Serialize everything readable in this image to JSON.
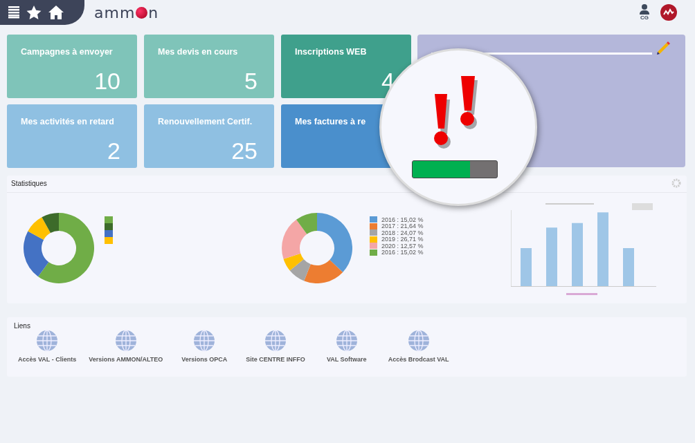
{
  "header": {
    "logo": {
      "before": "amm",
      "after": "n"
    },
    "user": {
      "initials": "CG"
    }
  },
  "tiles": [
    {
      "title": "Campagnes à envoyer",
      "value": "10",
      "color": "#7fc4b9"
    },
    {
      "title": "Mes devis en cours",
      "value": "5",
      "color": "#7fc4b9"
    },
    {
      "title": "Inscriptions WEB",
      "value": "4",
      "color": "#3fa08c"
    },
    {
      "title": "Mes activités en retard",
      "value": "2",
      "color": "#8fc0e2"
    },
    {
      "title": "Renouvellement Certif.",
      "value": "25",
      "color": "#8fc0e2"
    },
    {
      "title": "Mes factures à re",
      "color": "#4a8fcc"
    }
  ],
  "alert": {
    "level": 0.68
  },
  "stats": {
    "title": "Statistiques",
    "donut1_legend": [
      {
        "color": "#70ad47"
      },
      {
        "color": "#3d6b2a"
      },
      {
        "color": "#4472c4"
      },
      {
        "color": "#ffc000"
      }
    ],
    "donut2_legend": [
      {
        "label": "2016 : 15,02 %",
        "color": "#5b9bd5"
      },
      {
        "label": "2017 : 21,64 %",
        "color": "#ed7d31"
      },
      {
        "label": "2018 : 24,07 %",
        "color": "#a5a5a5"
      },
      {
        "label": "2019 : 26,71 %",
        "color": "#ffc000"
      },
      {
        "label": "2020 : 12,57 %",
        "color": "#f4a6a6"
      },
      {
        "label": "2016 : 15,02 %",
        "color": "#70ad47"
      }
    ]
  },
  "links": {
    "title": "Liens",
    "items": [
      "Accès VAL - Clients",
      "Versions AMMON/ALTEO",
      "Versions OPCA",
      "Site CENTRE INFFO",
      "VAL Software",
      "Accès Brodcast VAL"
    ]
  }
}
